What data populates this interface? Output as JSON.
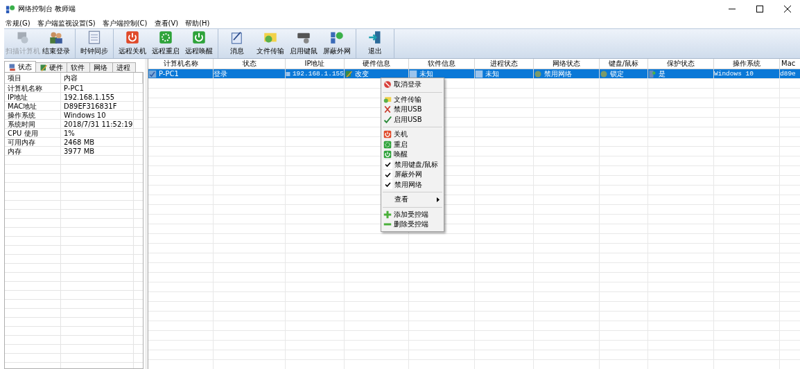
{
  "window": {
    "title": "网络控制台 教师端"
  },
  "menu_bar": [
    "常规(G)",
    "客户端监视设置(S)",
    "客户端控制(C)",
    "查看(V)",
    "帮助(H)"
  ],
  "toolbar": [
    [
      {
        "label": "扫描计算机",
        "disabled": true
      },
      {
        "label": "结束登录",
        "disabled": false
      }
    ],
    [
      {
        "label": "时钟同步",
        "disabled": false
      }
    ],
    [
      {
        "label": "远程关机",
        "disabled": false
      },
      {
        "label": "远程重启",
        "disabled": false
      },
      {
        "label": "远程唤醒",
        "disabled": false
      }
    ],
    [
      {
        "label": "消息",
        "disabled": false
      },
      {
        "label": "文件传输",
        "disabled": false
      },
      {
        "label": "启用键鼠",
        "disabled": false
      },
      {
        "label": "屏蔽外网",
        "disabled": false
      }
    ],
    [
      {
        "label": "退出",
        "disabled": false
      }
    ]
  ],
  "left_panel": {
    "tabs": [
      {
        "label": "状态",
        "selected": true
      },
      {
        "label": "硬件",
        "selected": false
      },
      {
        "label": "软件",
        "selected": false
      },
      {
        "label": "网络",
        "selected": false
      },
      {
        "label": "进程",
        "selected": false
      }
    ],
    "columns": [
      "项目",
      "内容"
    ],
    "rows": [
      [
        "计算机名称",
        "P-PC1"
      ],
      [
        "IP地址",
        "192.168.1.155"
      ],
      [
        "MAC地址",
        "D89EF316831F"
      ],
      [
        "操作系统",
        "Windows 10"
      ],
      [
        "系统时间",
        "2018/7/31  11:52:19"
      ],
      [
        "CPU 使用",
        "1%"
      ],
      [
        "可用内存",
        "2468 MB"
      ],
      [
        "内存",
        "3977 MB"
      ]
    ]
  },
  "table": {
    "columns": [
      "计算机名称",
      "状态",
      "IP地址",
      "硬件信息",
      "软件信息",
      "进程状态",
      "网络状态",
      "键盘/鼠标",
      "保护状态",
      "操作系统",
      "Mac"
    ],
    "rows": [
      {
        "selected": true,
        "cells": [
          "P-PC1",
          "登录",
          "192.168.1.155",
          "改变",
          "未知",
          "未知",
          "禁用网络",
          "锁定",
          "是",
          "Windows 10",
          "d89e"
        ]
      }
    ]
  },
  "context_menu": [
    [
      {
        "label": "取消登录",
        "kind": "icon"
      }
    ],
    [
      {
        "label": "文件传输",
        "kind": "icon"
      },
      {
        "label": "禁用USB",
        "kind": "icon"
      },
      {
        "label": "启用USB",
        "kind": "icon"
      }
    ],
    [
      {
        "label": "关机",
        "kind": "icon"
      },
      {
        "label": "重启",
        "kind": "icon"
      },
      {
        "label": "唤醒",
        "kind": "icon"
      },
      {
        "label": "禁用键盘/鼠标",
        "kind": "check",
        "checked": true
      },
      {
        "label": "屏蔽外网",
        "kind": "check",
        "checked": true
      },
      {
        "label": "禁用网络",
        "kind": "check",
        "checked": true
      }
    ],
    [
      {
        "label": "查看",
        "kind": "submenu"
      }
    ],
    [
      {
        "label": "添加受控端",
        "kind": "icon"
      },
      {
        "label": "删除受控端",
        "kind": "icon"
      }
    ]
  ]
}
